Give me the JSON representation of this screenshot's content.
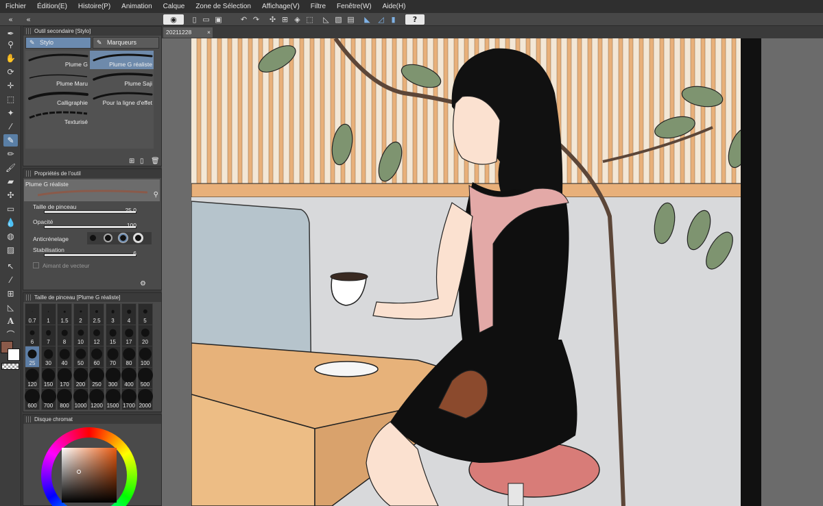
{
  "menu": [
    "Fichier",
    "Édition(E)",
    "Histoire(P)",
    "Animation",
    "Calque",
    "Zone de Sélection",
    "Affichage(V)",
    "Filtre",
    "Fenêtre(W)",
    "Aide(H)"
  ],
  "subtool_panel": {
    "title": "Outil secondaire [Stylo]",
    "tabs": [
      "Stylo",
      "Marqueurs"
    ],
    "brushes": [
      "Plume G",
      "Plume G réaliste",
      "Plume Maru",
      "Plume Saji",
      "Calligraphie",
      "Pour la ligne d'effet",
      "Texturisé"
    ]
  },
  "tool_properties": {
    "title": "Propriétés de l'outil",
    "preset_name": "Plume G réaliste",
    "brush_size_label": "Taille de pinceau",
    "brush_size_value": "25.0",
    "opacity_label": "Opacité",
    "opacity_value": "100",
    "antialias_label": "Anticrénelage",
    "stabilization_label": "Stabilisation",
    "stabilization_value": "6",
    "vector_magnet_label": "Aimant de vecteur"
  },
  "brush_size_panel": {
    "title": "Taille de pinceau [Plume G réaliste]",
    "sizes": [
      "0.7",
      "1",
      "1.5",
      "2",
      "2.5",
      "3",
      "4",
      "5",
      "6",
      "7",
      "8",
      "10",
      "12",
      "15",
      "17",
      "20",
      "25",
      "30",
      "40",
      "50",
      "60",
      "70",
      "80",
      "100",
      "120",
      "150",
      "170",
      "200",
      "250",
      "300",
      "400",
      "500",
      "600",
      "700",
      "800",
      "1000",
      "1200",
      "1500",
      "1700",
      "2000"
    ],
    "selected": "25"
  },
  "color_panel": {
    "title": "Disque chromat",
    "main_color": "#8a5a4a",
    "sub_color": "#ffffff"
  },
  "document": {
    "tab_name": "20211228"
  }
}
